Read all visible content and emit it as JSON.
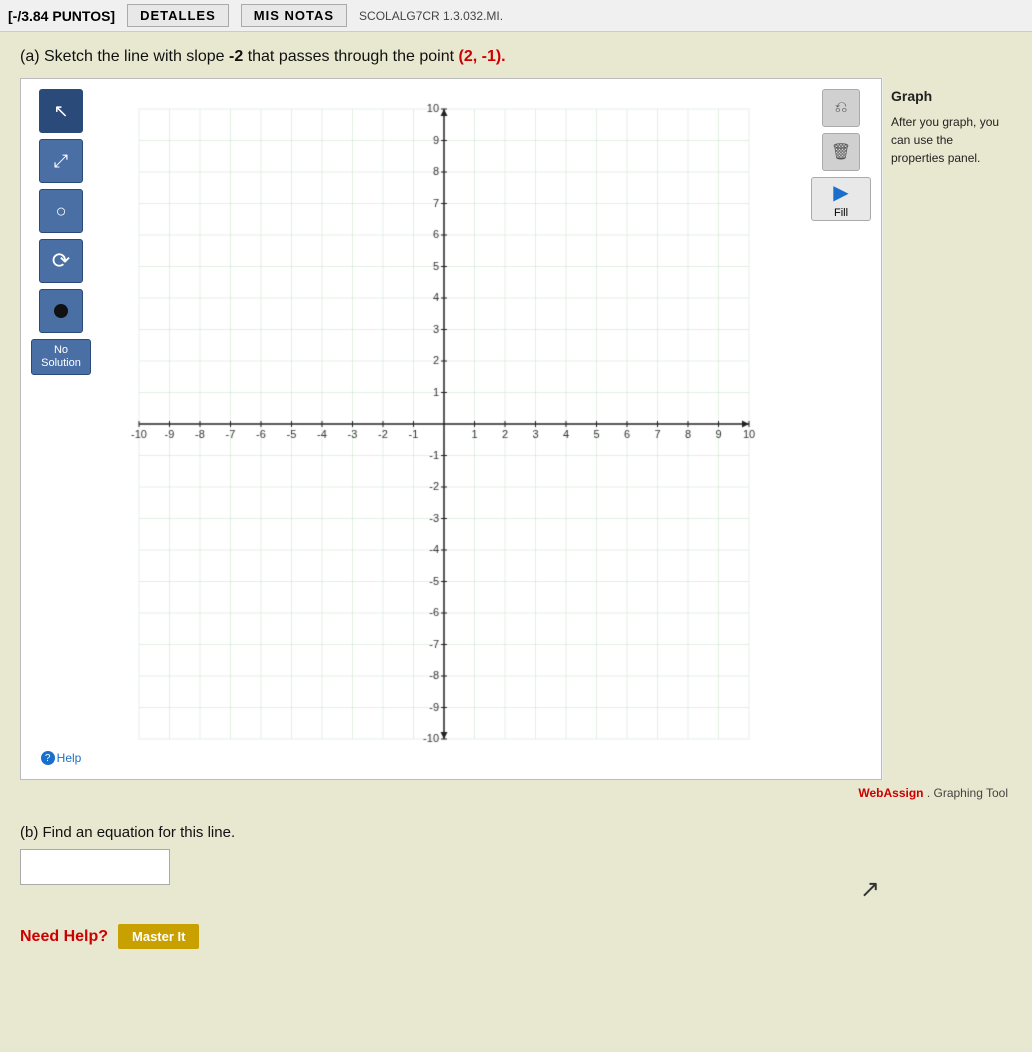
{
  "topbar": {
    "score": "[-/3.84 PUNTOS]",
    "btn1": "DETALLES",
    "btn2": "MIS NOTAS",
    "btn3": "SCOLALG7CR 1.3.032.MI."
  },
  "problem": {
    "part_a": "(a) Sketch the line with slope",
    "slope": "-2",
    "middle": "that passes through the point",
    "point": "(2, -1).",
    "part_b": "(b) Find an equation for this line."
  },
  "graph": {
    "x_min": -10,
    "x_max": 10,
    "y_min": -10,
    "y_max": 10,
    "x_labels": [
      "-10",
      "-9",
      "-8",
      "-7",
      "-6",
      "-5",
      "-4",
      "-3",
      "-2",
      "-1",
      "1",
      "2",
      "3",
      "4",
      "5",
      "6",
      "7",
      "8",
      "9",
      "10"
    ],
    "y_labels": [
      "-10",
      "-9",
      "-8",
      "-7",
      "-6",
      "-5",
      "-4",
      "-3",
      "-2",
      "-1",
      "1",
      "2",
      "3",
      "4",
      "5",
      "6",
      "7",
      "8",
      "9",
      "10"
    ]
  },
  "tools": {
    "cursor_label": "↖",
    "resize_label": "⤢",
    "circle_label": "○",
    "curve_label": "↺",
    "dot_label": "•",
    "no_solution_label": "No\nSolution",
    "help_label": "Help"
  },
  "right_panel": {
    "graph_title": "Graph",
    "description": "After you graph, you can use the properties panel.",
    "fill_label": "Fill",
    "fill_icon": "▶"
  },
  "webassign": {
    "prefix": "WebAssign",
    "suffix": ". Graphing Tool"
  },
  "part_b_input": {
    "placeholder": ""
  },
  "need_help": {
    "label": "Need Help?",
    "master_it": "Master It"
  }
}
